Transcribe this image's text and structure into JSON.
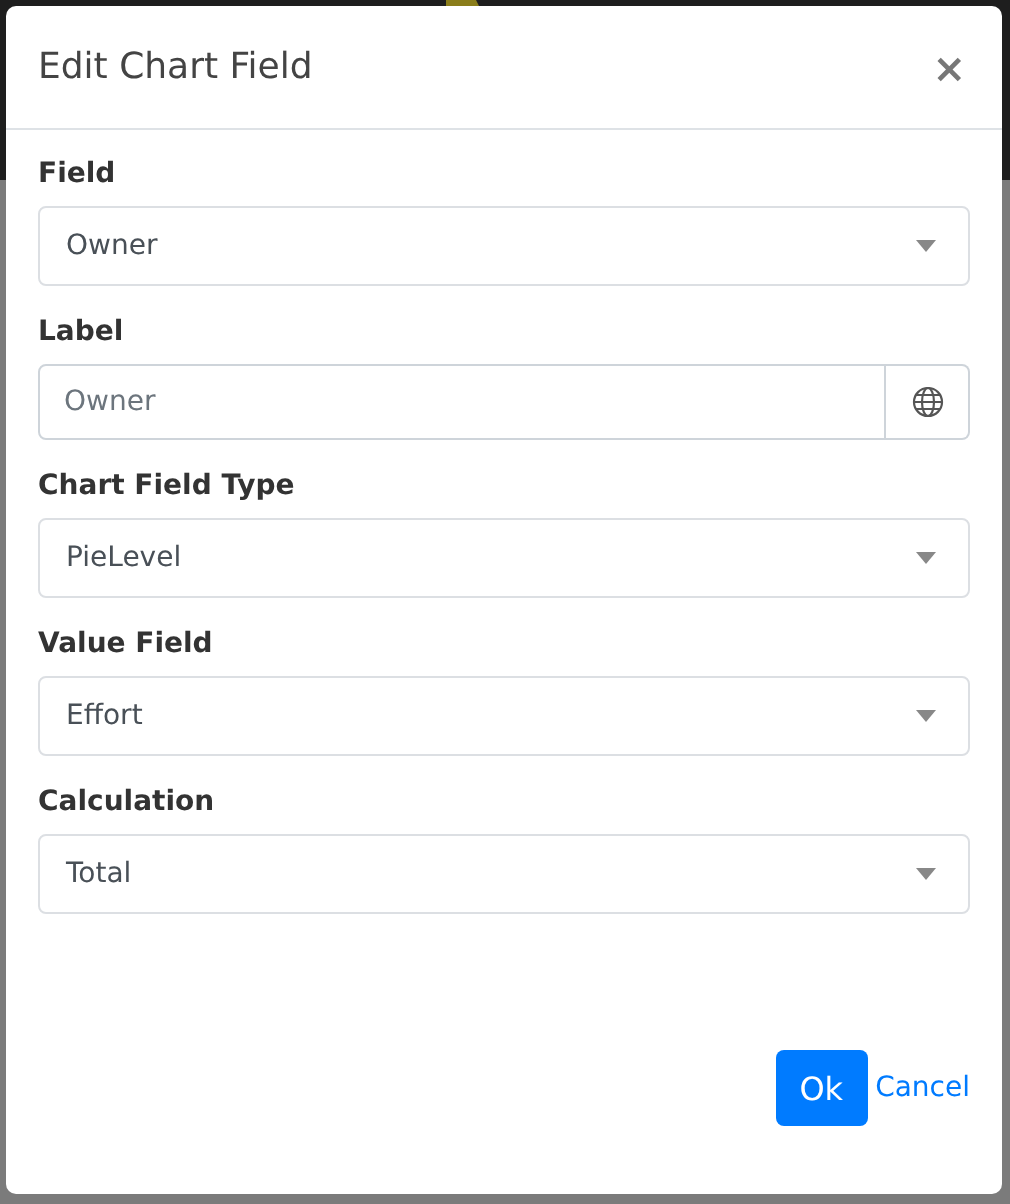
{
  "dialog": {
    "title": "Edit Chart Field",
    "close": "×"
  },
  "fields": [
    {
      "kind": "select",
      "label": "Field",
      "value": "Owner"
    },
    {
      "kind": "text",
      "label": "Label",
      "placeholder": "Owner"
    },
    {
      "kind": "select",
      "label": "Chart Field Type",
      "value": "PieLevel"
    },
    {
      "kind": "select",
      "label": "Value Field",
      "value": "Effort"
    },
    {
      "kind": "select",
      "label": "Calculation",
      "value": "Total"
    }
  ],
  "buttons": [
    {
      "kind": "primary",
      "label": "Ok"
    },
    {
      "kind": "link",
      "label": "Cancel"
    }
  ]
}
